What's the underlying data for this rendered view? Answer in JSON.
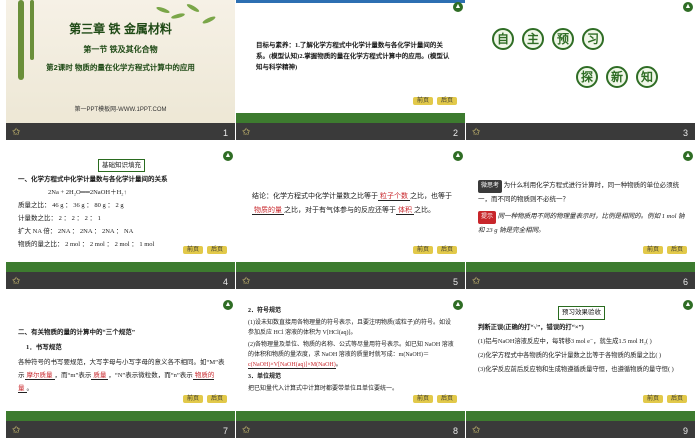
{
  "colors": {
    "accent_green": "#2f6d25",
    "highlight_red": "#c8262b",
    "strip_dark": "#3a3a3a"
  },
  "icons": {
    "star": "star-icon",
    "arrow": "up-arrow-icon"
  },
  "nav_labels": [
    "前页",
    "后页"
  ],
  "slides": [
    {
      "number": "1",
      "chapter": "第三章   铁 金属材料",
      "section": "第一节   铁及其化合物",
      "lesson": "第2课时   物质的量在化学方程式计算中的应用",
      "footer": "第一PPT模板网-WWW.1PPT.COM"
    },
    {
      "number": "2",
      "objectives": "目标与素养：1.了解化学方程式中化学计量数与各化学计量间的关系。(模型认知)2.掌握物质的量在化学方程式计算中的应用。(模型认知与科学精神)"
    },
    {
      "number": "3",
      "row1": [
        "自",
        "主",
        "预",
        "习"
      ],
      "row2": [
        "探",
        "新",
        "知"
      ]
    },
    {
      "number": "4",
      "box_title": "基础知识填充",
      "heading": "一、化学方程式中化学计量数与各化学计量间的关系",
      "equation": "2Na   +   2H₂O══2NaOH＋H₂↑",
      "rows": [
        "质量之比：   46 g   ：  36 g   ：  80 g   ：  2 g",
        "计量数之比：   2   ：   2   ：   2   ：   1",
        "扩大 NA 倍：   2NA   ：   2NA   ：   2NA   ：  NA",
        "物质的量之比：  2 mol   ：  2 mol   ：  2 mol   ：  1 mol"
      ]
    },
    {
      "number": "5",
      "conclusion_a": "结论：化学方程式中化学计量数之比等于",
      "answer_1": "粒子个数",
      "conclusion_b": "之比，也等于",
      "answer_2": "物质的量",
      "conclusion_c": "之比，对于有气体参与的反应还等于",
      "answer_3": "体积",
      "conclusion_d": "之比。"
    },
    {
      "number": "6",
      "tag_think": "微思考",
      "question": "为什么利用化学方程式进行计算时，同一种物质的单位必须统一，而不同的物质则不必统一？",
      "tag_hint": "提示",
      "answer": "同一种物质用不同的物理量表示时，比例是相同的。例如 1 mol 钠和 23 g 钠是完全相同。"
    },
    {
      "number": "7",
      "heading": "二、有关物质的量的计算中的“三个规范”",
      "sub": "1．书写规范",
      "line1": "各种符号的书写要规范，大写字母与小写字母的意义各不相同。如“M”表示",
      "blank_1": "摩尔质量",
      "line2": "，而“m”表示",
      "blank_2": "质量",
      "line3": "，“N”表示微粒数，而“n”表示",
      "blank_3": "物质的量",
      "line4": "。"
    },
    {
      "number": "8",
      "sub1": "2．符号规范",
      "p1": "(1)设未知数直接用各物理量的符号表示，且要注明物质(或粒子)的符号。如设参加反应 HCl 溶液的体积为 V[HCl(aq)]。",
      "p2": "(2)各物理量及单位、物质的名称、公式等尽量用符号表示。如已知 NaOH 溶液的体积和物质的量浓度，求 NaOH 溶液的质量时就写成：m(NaOH)＝",
      "formula": "c(NaOH)×V[NaOH(aq)]×M(NaOH)",
      "p2_end": "。",
      "sub2": "3．单位规范",
      "p3": "把已知量代入计算式中计算时都要带单位且单位要统一。"
    },
    {
      "number": "9",
      "box_title": "预习效果验收",
      "intro": "判断正误(正确的打“√”，错误的打“×”)",
      "q1": "(1)铝与NaOH溶液反应中，每转移3 mol e⁻，就生成1.5 mol H₂(    )",
      "q2": "(2)化学方程式中各物质的化学计量数之比等于各物质的质量之比(    )",
      "q3": "(3)化学反应前后反应物和生成物遵循质量守恒，也遵循物质的量守恒(    )"
    }
  ]
}
